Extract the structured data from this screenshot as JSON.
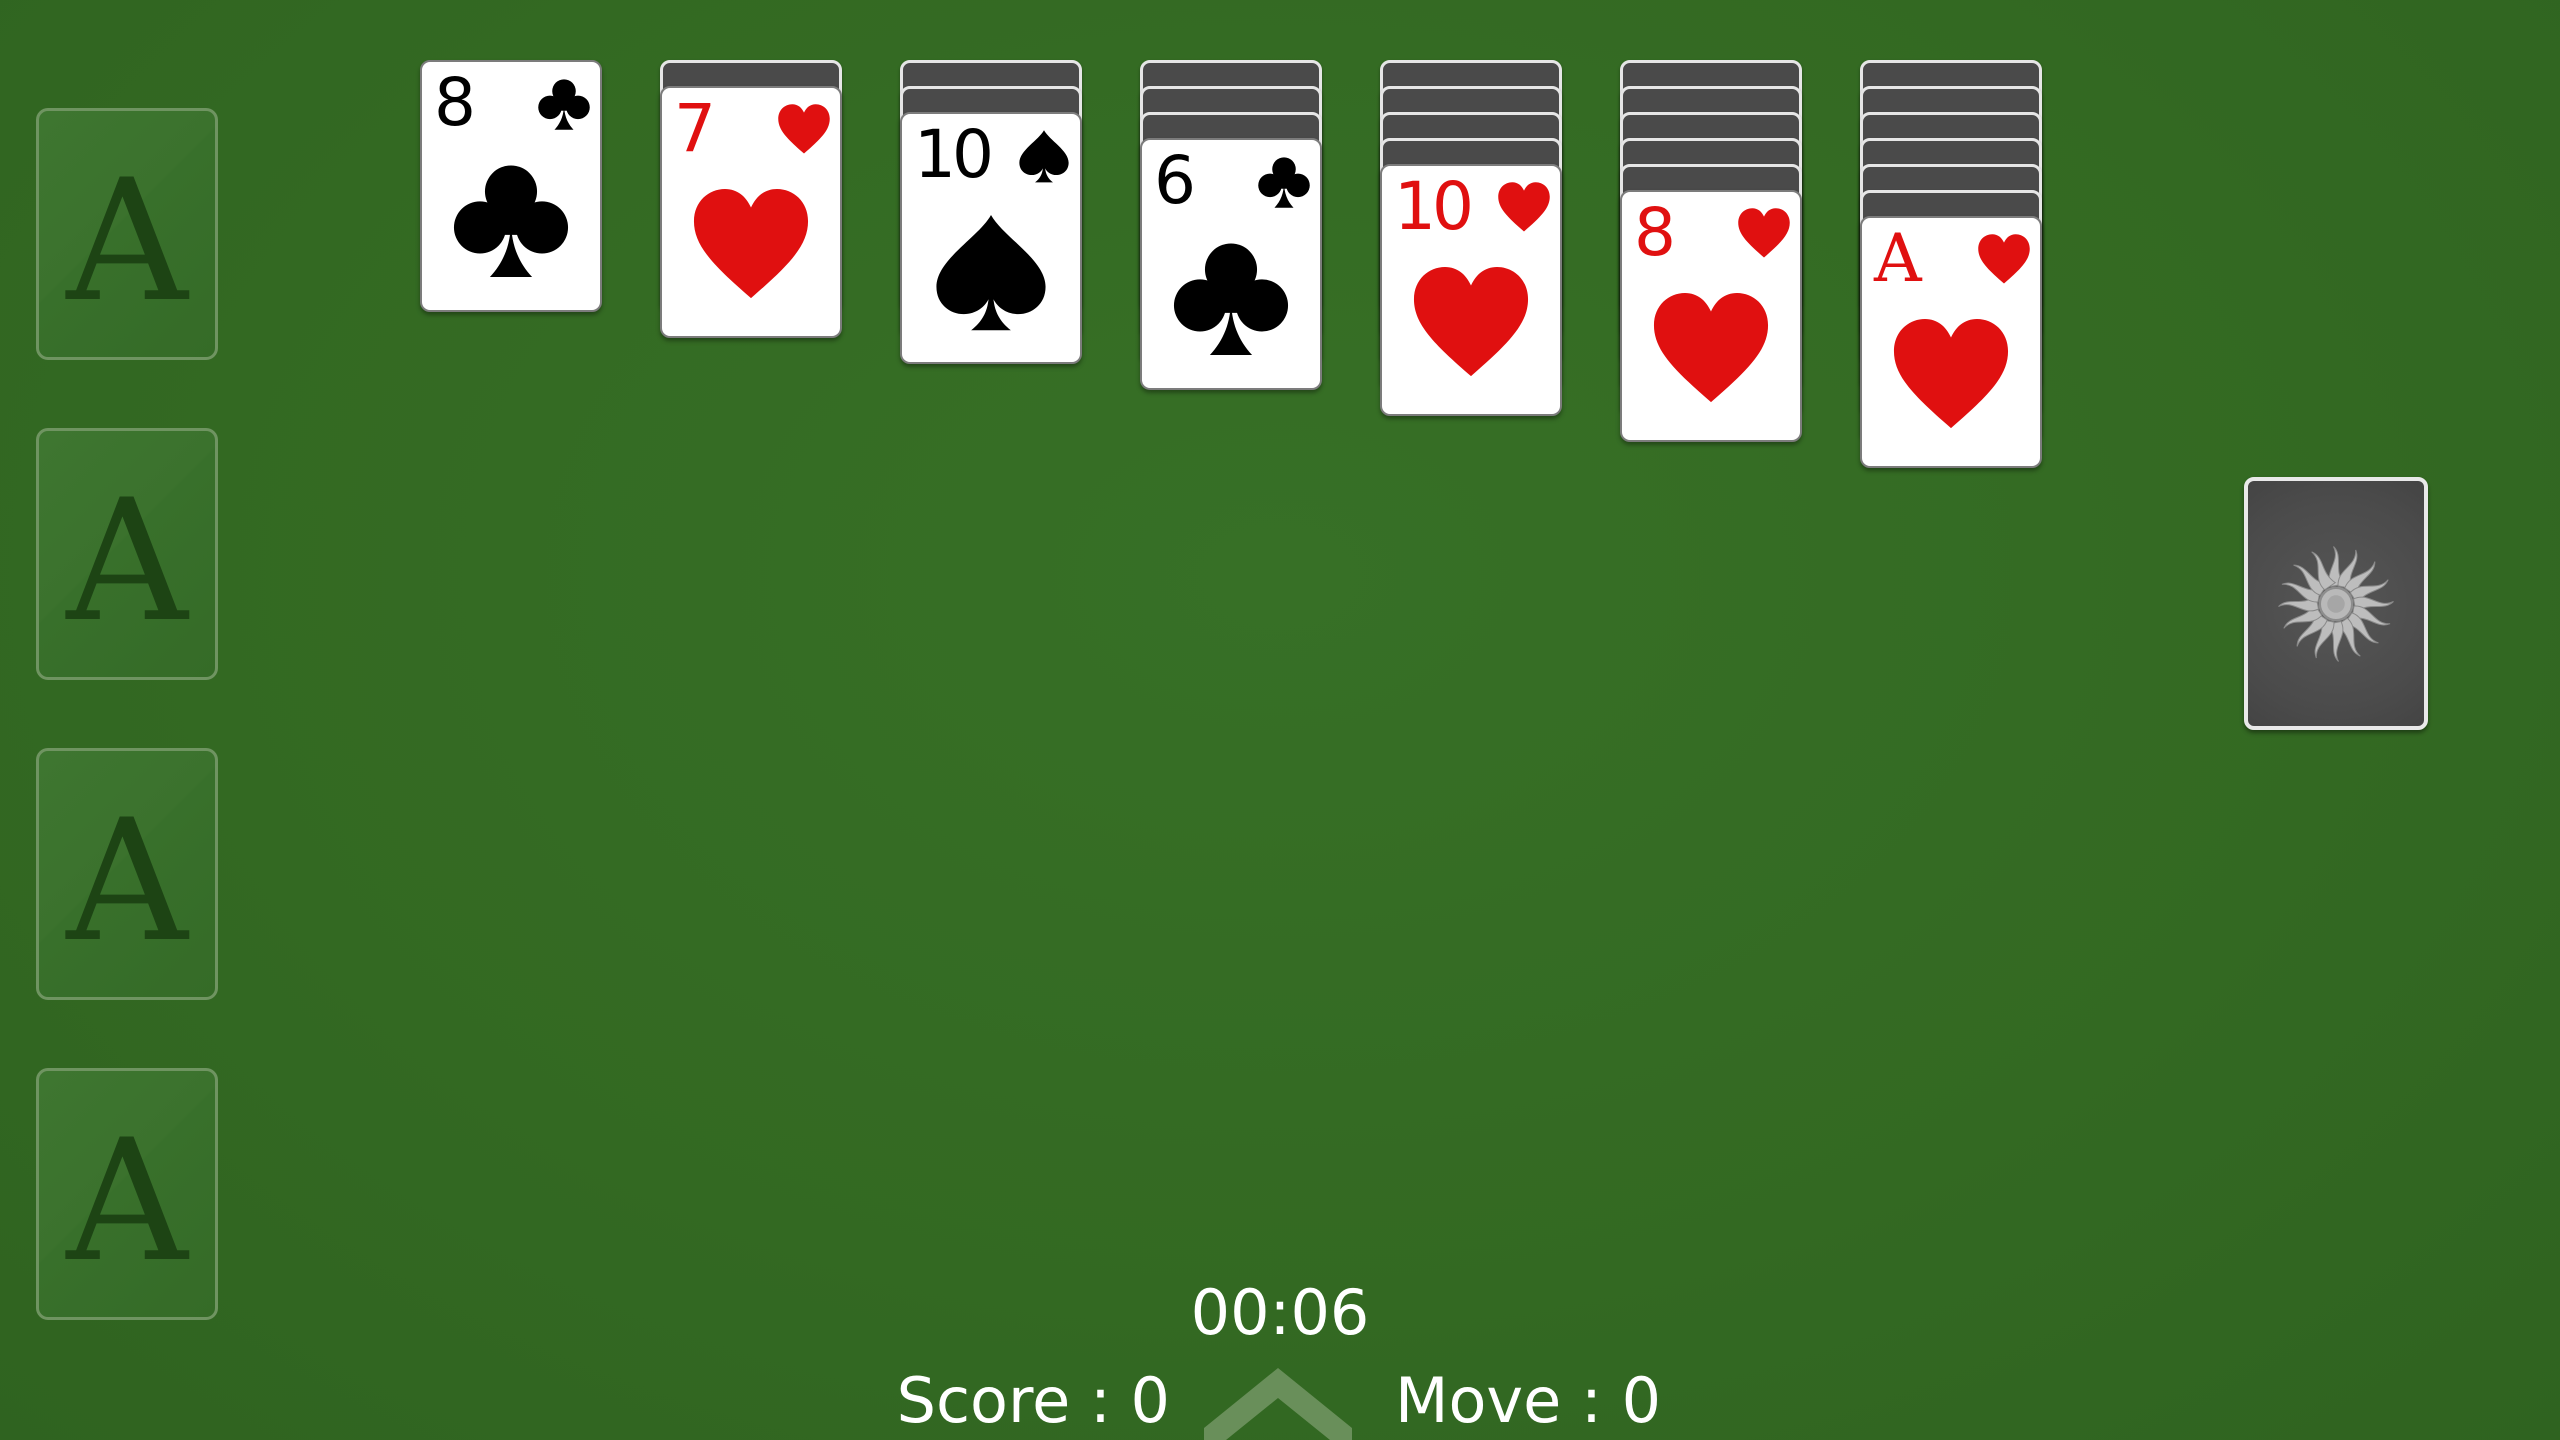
{
  "colors": {
    "felt": "#346a24",
    "card_red": "#e01010",
    "card_black": "#000000",
    "card_back": "#4a4a4a"
  },
  "foundations": [
    {
      "placeholder": "A"
    },
    {
      "placeholder": "A"
    },
    {
      "placeholder": "A"
    },
    {
      "placeholder": "A"
    }
  ],
  "tableau": [
    {
      "face_down_count": 0,
      "top_card": {
        "rank": "8",
        "suit": "clubs",
        "color": "black"
      }
    },
    {
      "face_down_count": 1,
      "top_card": {
        "rank": "7",
        "suit": "hearts",
        "color": "red"
      }
    },
    {
      "face_down_count": 2,
      "top_card": {
        "rank": "10",
        "suit": "spades",
        "color": "black"
      }
    },
    {
      "face_down_count": 3,
      "top_card": {
        "rank": "6",
        "suit": "clubs",
        "color": "black"
      }
    },
    {
      "face_down_count": 4,
      "top_card": {
        "rank": "10",
        "suit": "hearts",
        "color": "red"
      }
    },
    {
      "face_down_count": 5,
      "top_card": {
        "rank": "8",
        "suit": "hearts",
        "color": "red"
      }
    },
    {
      "face_down_count": 6,
      "top_card": {
        "rank": "A",
        "suit": "hearts",
        "color": "red"
      }
    }
  ],
  "stock": {
    "icon": "sun-icon"
  },
  "status": {
    "timer": "00:06",
    "score": "Score : 0",
    "move": "Move : 0",
    "menu_icon": "chevron-up-icon"
  }
}
